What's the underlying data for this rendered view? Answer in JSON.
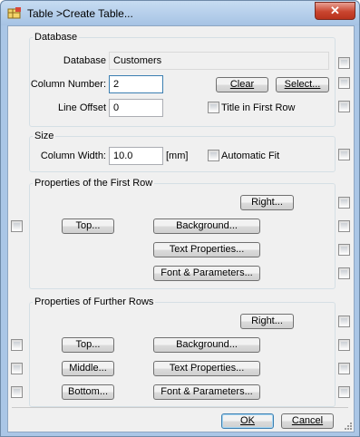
{
  "window": {
    "title": "Table >Create Table...",
    "close_glyph": "✕",
    "app_icon": "table-app-icon"
  },
  "database": {
    "group_label": "Database",
    "database_label": "Database",
    "database_value": "Customers",
    "column_number_label": "Column Number:",
    "column_number_value": "2",
    "line_offset_label": "Line Offset",
    "line_offset_value": "0",
    "clear_label": "Clear",
    "select_label": "Select...",
    "title_first_row_label": "Title in First Row"
  },
  "size": {
    "group_label": "Size",
    "column_width_label": "Column Width:",
    "column_width_value": "10.0",
    "unit_label": "[mm]",
    "automatic_fit_label": "Automatic Fit"
  },
  "first_row": {
    "group_label": "Properties of the First Row",
    "right_label": "Right...",
    "top_label": "Top...",
    "background_label": "Background...",
    "text_properties_label": "Text Properties...",
    "font_label": "Font & Parameters..."
  },
  "further_rows": {
    "group_label": "Properties of Further Rows",
    "right_label": "Right...",
    "top_label": "Top...",
    "background_label": "Background...",
    "middle_label": "Middle...",
    "text_properties_label": "Text Properties...",
    "bottom_label": "Bottom...",
    "font_label": "Font & Parameters..."
  },
  "footer": {
    "ok_label": "OK",
    "cancel_label": "Cancel"
  },
  "colors": {
    "title_bar": "#aac6e6",
    "close_button": "#c9452f",
    "dialog_bg": "#f0f0f0",
    "focus_border": "#3c7fb1"
  }
}
